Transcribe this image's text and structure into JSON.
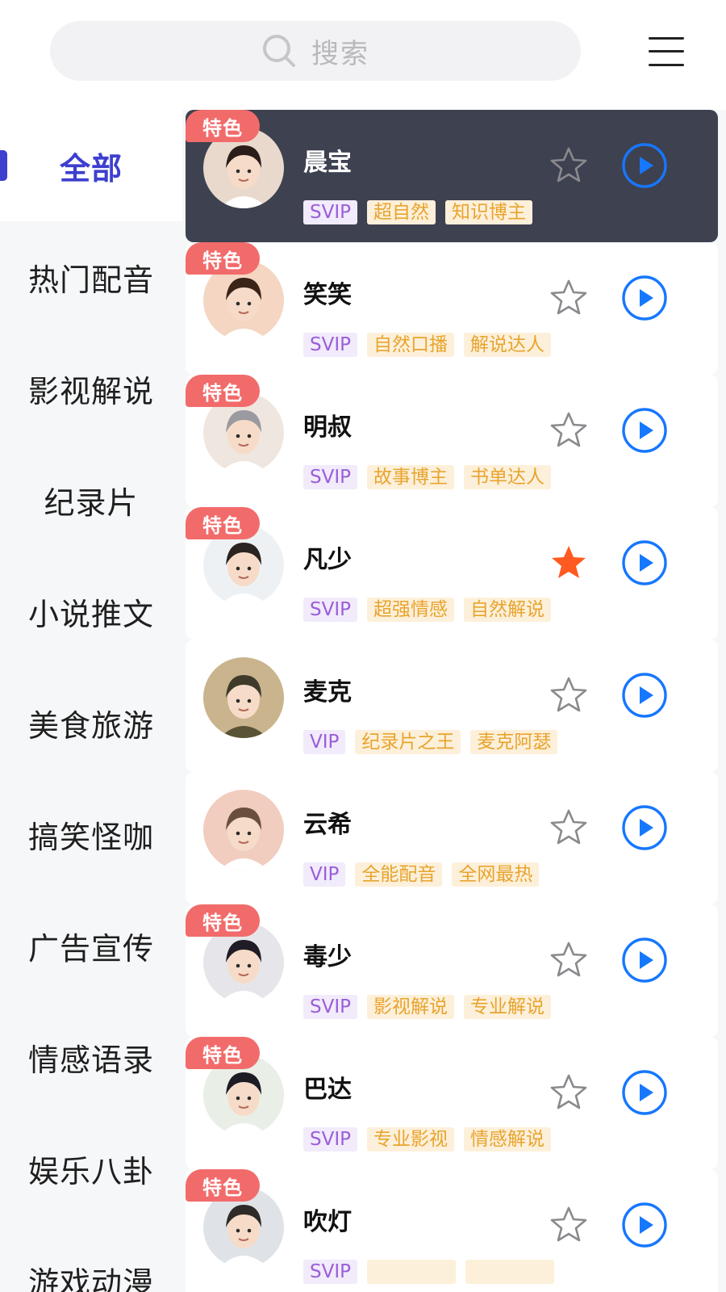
{
  "search": {
    "placeholder": "搜索"
  },
  "categories": [
    "全部",
    "热门配音",
    "影视解说",
    "纪录片",
    "小说推文",
    "美食旅游",
    "搞笑怪咖",
    "广告宣传",
    "情感语录",
    "娱乐八卦",
    "游戏动漫"
  ],
  "active_category": "全部",
  "badge_label": "特色",
  "voices": [
    {
      "name": "晨宝",
      "tags": [
        "SVIP",
        "超自然",
        "知识博主"
      ],
      "featured": true,
      "favorited": false,
      "avatar_color": "#e9d9cc"
    },
    {
      "name": "笑笑",
      "tags": [
        "SVIP",
        "自然口播",
        "解说达人"
      ],
      "featured": true,
      "favorited": false,
      "avatar_color": "#f4d6c2"
    },
    {
      "name": "明叔",
      "tags": [
        "SVIP",
        "故事博主",
        "书单达人"
      ],
      "featured": true,
      "favorited": false,
      "avatar_color": "#efe6df"
    },
    {
      "name": "凡少",
      "tags": [
        "SVIP",
        "超强情感",
        "自然解说"
      ],
      "featured": true,
      "favorited": true,
      "avatar_color": "#eef1f4"
    },
    {
      "name": "麦克",
      "tags": [
        "VIP",
        "纪录片之王",
        "麦克阿瑟"
      ],
      "featured": false,
      "favorited": false,
      "avatar_color": "#c9b48d"
    },
    {
      "name": "云希",
      "tags": [
        "VIP",
        "全能配音",
        "全网最热"
      ],
      "featured": false,
      "favorited": false,
      "avatar_color": "#f1cdbf"
    },
    {
      "name": "毒少",
      "tags": [
        "SVIP",
        "影视解说",
        "专业解说"
      ],
      "featured": true,
      "favorited": false,
      "avatar_color": "#e6e6ea"
    },
    {
      "name": "巴达",
      "tags": [
        "SVIP",
        "专业影视",
        "情感解说"
      ],
      "featured": true,
      "favorited": false,
      "avatar_color": "#e9efe6"
    },
    {
      "name": "吹灯",
      "tags": [
        "SVIP",
        "",
        ""
      ],
      "featured": true,
      "favorited": false,
      "avatar_color": "#dfe3e8"
    }
  ],
  "colors": {
    "accent": "#3d3fcf",
    "play_blue": "#1677ff",
    "fav_orange": "#ff5a1f",
    "badge_red": "#f26b6b",
    "active_card": "#3e4150"
  },
  "icons": {
    "search": "search-icon",
    "menu": "hamburger-menu-icon",
    "star": "star-icon",
    "play": "play-circle-icon"
  }
}
